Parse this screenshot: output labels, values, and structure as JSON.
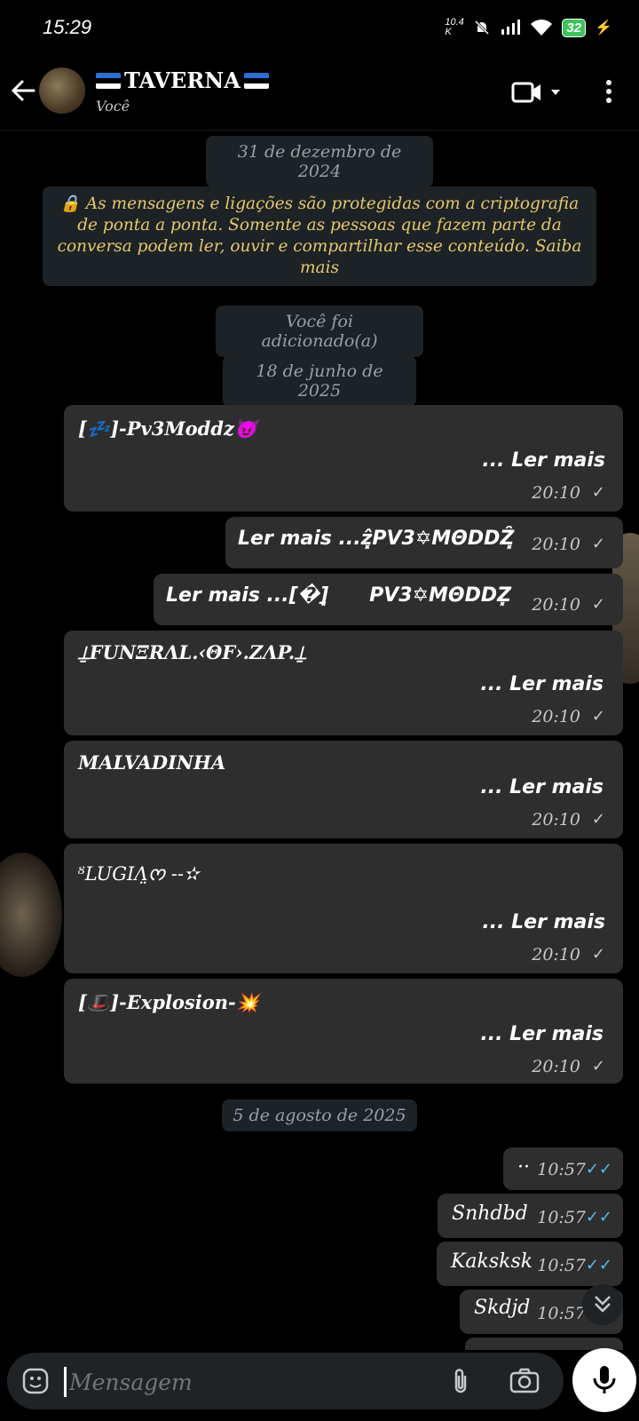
{
  "status_bar": {
    "time": "15:29",
    "net_speed": "10.4 K",
    "battery": "32"
  },
  "header": {
    "title": "TAVERNA",
    "subtitle": "Você"
  },
  "dates": {
    "d1": "31 de dezembro de 2024",
    "d2": "18 de junho de 2025",
    "d3": "5 de agosto de 2025"
  },
  "system": {
    "encryption": "🔒 As mensagens e ligações são protegidas com a criptografia de ponta a ponta. Somente as pessoas que fazem parte da conversa podem ler, ouvir e compartilhar esse conteúdo. Saiba mais",
    "added": "Você foi adicionado(a)"
  },
  "read_more": "... Ler mais",
  "messages": [
    {
      "name": "[💤]-Pv3Moddz😈",
      "time": "20:10"
    },
    {
      "text": "Ler mais ...ẑ͓PV3✡MΘDDẐ͓",
      "time": "20:10"
    },
    {
      "text": "Ler mais ...[�]͓      PV3✡MΘDDZ͓",
      "time": "20:10"
    },
    {
      "name": "⍊FUNΞRΛL.‹ΘF›.ZΛP.⍊",
      "time": "20:10"
    },
    {
      "name": "MALVADINHA",
      "time": "20:10"
    },
    {
      "name": "ᴽLUGIΛ̤ᰔ --✫",
      "time": "20:10"
    },
    {
      "name": "[🎩]-Explosion-💥",
      "time": "20:10"
    },
    {
      "text": "··",
      "time": "10:57"
    },
    {
      "text": "Snhdbd",
      "time": "10:57"
    },
    {
      "text": "Kaksksk",
      "time": "10:57"
    },
    {
      "text": "Skdjd",
      "time": "10:57"
    }
  ],
  "input": {
    "placeholder": "Mensagem"
  }
}
